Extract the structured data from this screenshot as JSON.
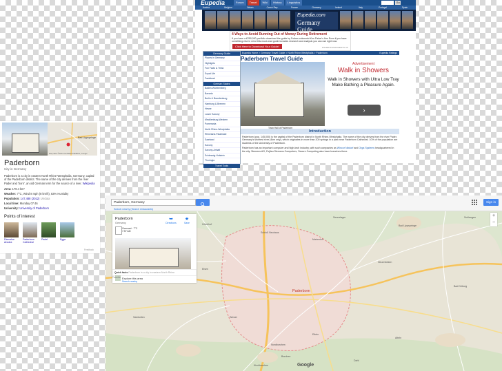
{
  "eupedia": {
    "logo": "Eupedia",
    "nav": [
      "Forum",
      "Travel",
      "Wiki",
      "History",
      "Linguistics"
    ],
    "go": "Go",
    "flags": [
      "Austria",
      "Belgium",
      "Britain",
      "Czech Rep.",
      "France",
      "Germany",
      "Ireland",
      "Italy",
      "Portugal",
      "Spain"
    ],
    "banner": {
      "line1": "Eupedia.com",
      "line2": "Germany Guide"
    },
    "ad": {
      "headline": "4 Ways to Avoid Running Out of Money During Retirement",
      "text": "If you have a £250,000 portfolio download the guide by Forbes columnist Ken Fisher's firm Even if you have something else in mind this must-read guide includes research and analysis you can use right now.",
      "button": "Click Here to Download Your Guide!",
      "footer": "FISHER INVESTMENTS UK"
    },
    "sidebar": {
      "header1": "Germany Guide",
      "items1": [
        "Places in Germany",
        "Highlights",
        "Fun Facts & Trivia",
        "Expat Life",
        "Factsheet"
      ],
      "header2": "German States",
      "items2": [
        "Baden-Württemberg",
        "Bavaria",
        "Berlin & Brandenburg",
        "Hamburg & Bremen",
        "Hesse",
        "Lower Saxony",
        "Mecklenburg-Western Pomerania",
        "North Rhine-Westphalia",
        "Rhineland-Palatinate",
        "Saarland",
        "Saxony",
        "Saxony-Anhalt",
        "Schleswig-Holstein",
        "Thuringia"
      ],
      "header3": "Travel Tools"
    },
    "breadcrumb": "Eupedia Home > Germany Travel Guide > North Rhine-Westphalia > Paderborn",
    "edit": "Eupedia Ratings",
    "title": "Paderborn Travel Guide",
    "caption": "Town Hall of Paderborn",
    "advert": {
      "label": "Advertisement",
      "headline": "Walk in Showers",
      "body": "Walk in Showers with Ultra Low Tray Make Bathing a Pleasure Again.",
      "arrow": "›"
    },
    "intro_heading": "Introduction",
    "intro_p1": "Paderborn (pop. 145,000) is the capital of the Paderborn district in North Rhine-Westphalia. The name of the city derives from the river Pader, Germany's shortest river (4km only), which originates in more than 200 springs in a park near Paderborn Cathedral. 10% of the population are students of the University of Paderborn.",
    "intro_p2a": "Paderborn has an important computer and high-tech industry, with such companies as ",
    "intro_link1": "Wincor Nixdorf",
    "intro_p2b": " and ",
    "intro_link2": "Orga Systems",
    "intro_p2c": " headquartered in the city. Siemens AG, Fujitsu Siemens Computers, Secure Computing also have branches there."
  },
  "knowledge_panel": {
    "title": "Paderborn",
    "subtitle": "City in Germany",
    "map_label": "Bad Lippspringe",
    "map_credit": "Map data ©2014 GeoBasis-DE/BKG, Google",
    "description": "Paderborn is a city in eastern North Rhine-Westphalia, Germany, capital of the Paderborn district. The name of the city derives from the river Pader and 'born', an old German term for the source of a river.",
    "desc_link": "Wikipedia",
    "facts": [
      {
        "label": "Area:",
        "value": "179.4 km²"
      },
      {
        "label": "Weather:",
        "value": "7°C, Wind 8 mph (8 km/h), 83% Humidity"
      },
      {
        "label": "Population:",
        "value": "147,488 (2012)",
        "extra": " UNdata"
      },
      {
        "label": "Local time:",
        "value": "Monday 07:46"
      },
      {
        "label": "University:",
        "value": "University of Paderborn"
      }
    ],
    "poi_heading": "Points of interest",
    "poi": [
      "Diemelse Ansdra",
      "Paderborn Cathedral",
      "Padel",
      "Egge"
    ],
    "feedback": "Feedback"
  },
  "map": {
    "search_value": "Paderborn, Germany",
    "search_nearby": "Search nearby  (Search restaurants)",
    "sign_in": "Sign in",
    "card": {
      "title": "Paderborn",
      "subtitle": "Germany",
      "directions": "Directions",
      "save": "Save",
      "info1": "Overcast · 7°C",
      "info2": "7:57 AM",
      "explore": "Explore this area",
      "explore_link": "Search nearby"
    },
    "quick_facts_label": "Quick facts",
    "quick_facts_text": "Paderborn is a city in eastern North Rhine",
    "tagline": "Traveller",
    "city_label": "Paderborn",
    "logo": "Google",
    "zoom_in": "+",
    "zoom_out": "−",
    "towns": [
      "Bad Lippspringe",
      "Schlangen",
      "Neuenbeken",
      "Schloß Neuhaus",
      "Marienloh",
      "Wewer",
      "Elsen",
      "Salzkotten",
      "Borchen",
      "Dahl",
      "Kirchborchen",
      "Nordborchen",
      "Etteln",
      "Atteln",
      "Hövelhof",
      "Sennelager",
      "Bad Driburg"
    ]
  }
}
